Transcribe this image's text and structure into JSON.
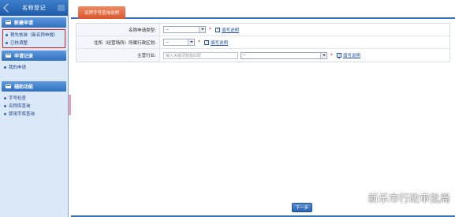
{
  "sidebar": {
    "title": "名称登记",
    "sections": [
      {
        "title": "新建申请",
        "items": [
          "预先核准（新名称申报）",
          "已核调整"
        ]
      },
      {
        "title": "申请记录",
        "items": [
          "我的申请"
        ]
      },
      {
        "title": "辅助功能",
        "items": [
          "字号检查",
          "名称库查询",
          "禁用字库查询"
        ]
      }
    ]
  },
  "main": {
    "tab_label": "名称字号查询说明",
    "form": {
      "rows": [
        {
          "label": "名称申请类型:",
          "select_value": "--",
          "required_mark": "*",
          "help": "填写说明"
        },
        {
          "label": "住所（经营场所）所属行政区划:",
          "select_value": "--",
          "required_mark": "*",
          "help": "填写说明"
        },
        {
          "label": "主营行业:",
          "input_placeholder": "输入关键词智能匹配",
          "select_value": "--",
          "required_mark": "*",
          "help": "填写说明"
        }
      ]
    },
    "next_button": "下一步"
  },
  "watermark": {
    "text": "新乐市行政审批局",
    "icon": "wechat-icon"
  },
  "colors": {
    "sidebar_bg": "#dbe8f7",
    "header_blue": "#1f5ca8",
    "tab_orange": "#d9572e",
    "highlight_red": "#e02020",
    "link_blue": "#1f4fa8"
  }
}
